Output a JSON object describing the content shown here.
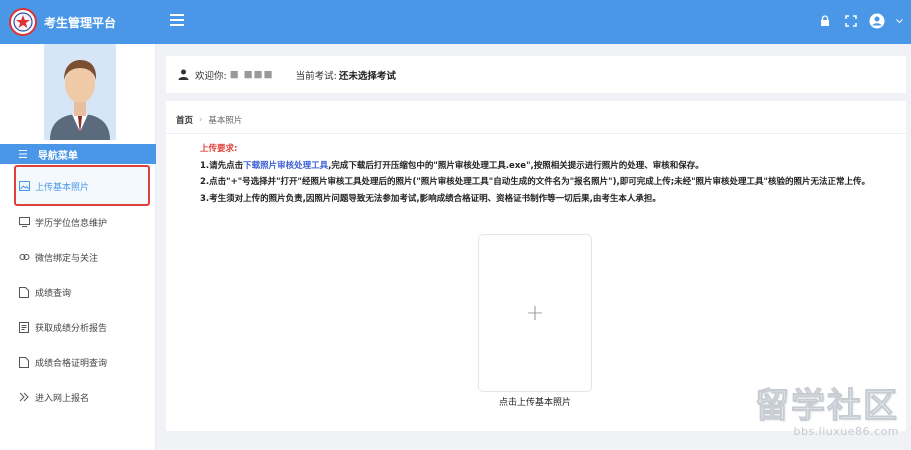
{
  "sidebar": {
    "brand_title": "考生管理平台",
    "nav_header": "导航菜单",
    "items": [
      {
        "label": "上传基本照片",
        "icon": "image-icon",
        "active": true
      },
      {
        "label": "学历学位信息维护",
        "icon": "monitor-icon"
      },
      {
        "label": "微信绑定与关注",
        "icon": "link-icon"
      },
      {
        "label": "成绩查询",
        "icon": "document-icon"
      },
      {
        "label": "获取成绩分析报告",
        "icon": "report-icon"
      },
      {
        "label": "成绩合格证明查询",
        "icon": "document-icon"
      },
      {
        "label": "进入网上报名",
        "icon": "enter-icon"
      }
    ]
  },
  "topbar": {
    "icons": [
      "lock-icon",
      "fullscreen-icon",
      "user-circle-icon",
      "chevron-down-icon"
    ]
  },
  "welcome": {
    "label": "欢迎你:",
    "username": "■ ■■■",
    "exam_label": "当前考试:",
    "exam_value": "还未选择考试"
  },
  "breadcrumb": {
    "home": "首页",
    "current": "基本照片"
  },
  "notes": {
    "title": "上传要求:",
    "line1_prefix": "1.请先点击",
    "line1_link": "下载照片审核处理工具",
    "line1_suffix": ",完成下载后打开压缩包中的\"照片审核处理工具.exe\",按照相关提示进行照片的处理、审核和保存。",
    "line2": "2.点击\"+\"号选择并\"打开\"经照片审核工具处理后的照片(\"照片审核处理工具\"自动生成的文件名为\"报名照片\"),即可完成上传;未经\"照片审核处理工具\"核验的照片无法正常上传。",
    "line3": "3.考生须对上传的照片负责,因照片问题导致无法参加考试,影响成绩合格证明、资格证书制作等一切后果,由考生本人承担。"
  },
  "upload": {
    "plus": "+",
    "label": "点击上传基本照片"
  },
  "watermark": {
    "big": "留学社区",
    "small": "bbs.liuxue86.com"
  },
  "colors": {
    "primary": "#4a97e8",
    "highlight": "#e0403a",
    "link": "#3e62d6"
  }
}
